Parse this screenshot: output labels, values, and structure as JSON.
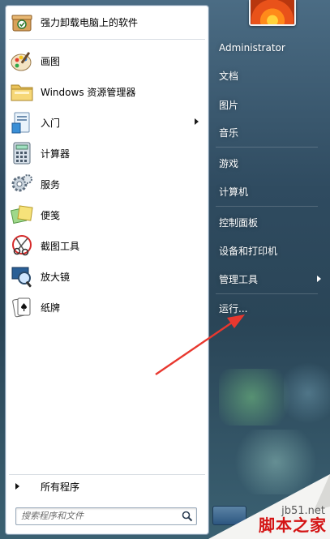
{
  "start_menu": {
    "programs": [
      {
        "label": "强力卸载电脑上的软件",
        "icon": "uninstall-box-icon"
      },
      {
        "label": "画图",
        "icon": "paint-palette-icon"
      },
      {
        "label": "Windows 资源管理器",
        "icon": "folder-explorer-icon"
      },
      {
        "label": "入门",
        "icon": "getting-started-icon",
        "has_submenu": true
      },
      {
        "label": "计算器",
        "icon": "calculator-icon"
      },
      {
        "label": "服务",
        "icon": "services-gear-icon"
      },
      {
        "label": "便笺",
        "icon": "sticky-notes-icon"
      },
      {
        "label": "截图工具",
        "icon": "snipping-tool-icon"
      },
      {
        "label": "放大镜",
        "icon": "magnifier-icon"
      },
      {
        "label": "纸牌",
        "icon": "solitaire-cards-icon"
      }
    ],
    "all_programs_label": "所有程序",
    "search": {
      "placeholder": "搜索程序和文件"
    },
    "right_items": [
      {
        "label": "Administrator"
      },
      {
        "label": "文档"
      },
      {
        "label": "图片"
      },
      {
        "label": "音乐"
      },
      {
        "label": "游戏"
      },
      {
        "label": "计算机"
      },
      {
        "label": "控制面板"
      },
      {
        "label": "设备和打印机"
      },
      {
        "label": "管理工具",
        "has_submenu": true
      },
      {
        "label": "运行..."
      }
    ]
  },
  "watermark": {
    "url": "jb51.net",
    "site": "脚本之家"
  },
  "colors": {
    "annotation_arrow": "#e8382f",
    "menu_right_bg": "#2f4b60"
  }
}
